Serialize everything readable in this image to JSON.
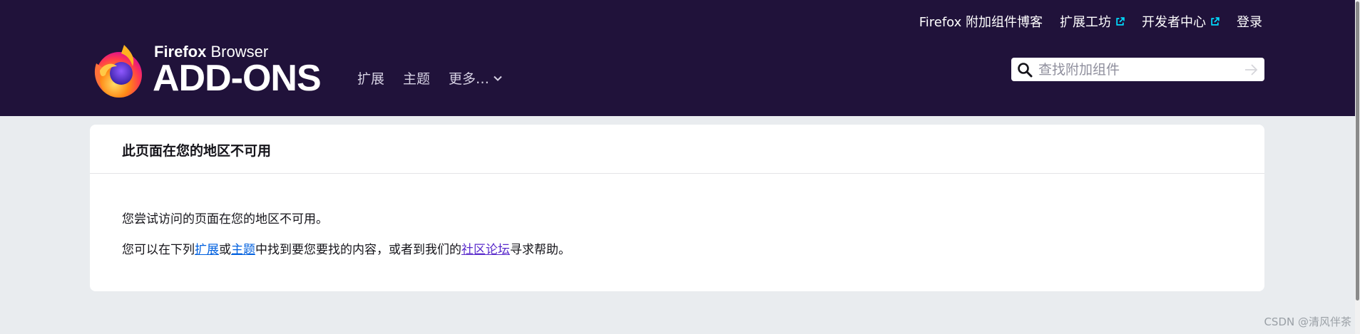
{
  "top_links": {
    "blog": "Firefox 附加组件博客",
    "workshop": "扩展工坊",
    "dev_hub": "开发者中心",
    "login": "登录"
  },
  "logo": {
    "brand_bold": "Firefox",
    "brand_light": " Browser",
    "addons": "ADD-ONS"
  },
  "nav": {
    "extensions": "扩展",
    "themes": "主题",
    "more": "更多…"
  },
  "search": {
    "placeholder": "查找附加组件"
  },
  "card": {
    "title": "此页面在您的地区不可用",
    "p1": "您尝试访问的页面在您的地区不可用。",
    "p2_a": "您可以在下列",
    "p2_link_ext": "扩展",
    "p2_b": "或",
    "p2_link_themes": "主题",
    "p2_c": "中找到要您要找的内容，或者到我们的",
    "p2_link_forum": "社区论坛",
    "p2_d": "寻求帮助。"
  },
  "watermark": "CSDN @清风伴茶",
  "colors": {
    "header_bg": "#20123a",
    "page_bg": "#e9ecef",
    "link": "#0060df",
    "link_visited": "#592acb",
    "external_icon": "#00ddff"
  }
}
